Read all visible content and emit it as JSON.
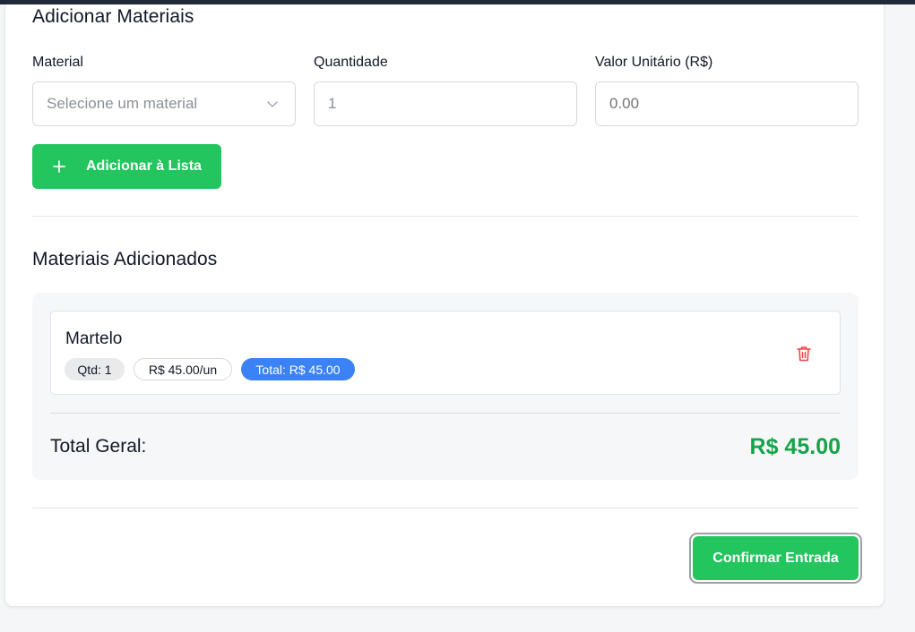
{
  "section_add": {
    "title": "Adicionar Materiais",
    "material_label": "Material",
    "material_placeholder": "Selecione um material",
    "quantity_label": "Quantidade",
    "quantity_value": "1",
    "unit_price_label": "Valor Unitário (R$)",
    "unit_price_placeholder": "0.00",
    "add_button_label": "Adicionar à Lista"
  },
  "section_list": {
    "title": "Materiais Adicionados",
    "items": [
      {
        "name": "Martelo",
        "qty": "Qtd: 1",
        "unit_price": "R$ 45.00/un",
        "total": "Total: R$ 45.00"
      }
    ],
    "grand_total_label": "Total Geral:",
    "grand_total_value": "R$ 45.00"
  },
  "confirm_button_label": "Confirmar Entrada",
  "colors": {
    "accent_green": "#22c55e",
    "total_green": "#16a34a",
    "badge_blue": "#3b82f6",
    "delete_red": "#ef4444"
  }
}
